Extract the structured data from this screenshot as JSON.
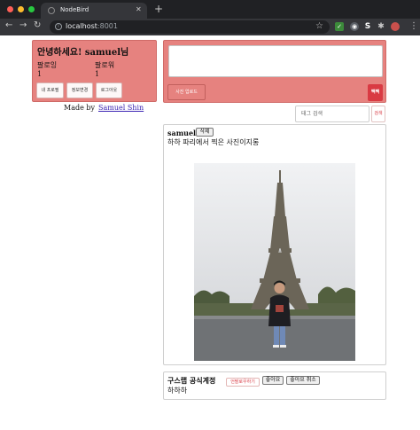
{
  "browser": {
    "tab_title": "NodeBird",
    "url_host": "localhost",
    "url_port": ":8001",
    "colors": {
      "close": "#ff5f57",
      "minimize": "#febc2e",
      "zoom": "#28c840"
    },
    "icons": [
      "back-icon",
      "forward-icon",
      "reload-icon",
      "info-icon",
      "star-icon",
      "extensions-icon",
      "menu-icon"
    ]
  },
  "profile": {
    "greeting": "안녕하세요! samuel님",
    "following_label": "팔로잉",
    "following_count": "1",
    "follower_label": "팔로워",
    "follower_count": "1",
    "buttons": {
      "my_profile": "내 프로필",
      "edit_info": "정보변경",
      "logout": "로그아웃"
    }
  },
  "footer": {
    "made_by": "Made by",
    "author_link": "Samuel Shin"
  },
  "post_form": {
    "upload_label": "사진 업로드",
    "submit_label": "짹짹"
  },
  "search": {
    "placeholder": "태그 검색",
    "button_label": "검색"
  },
  "posts": [
    {
      "author": "samuel",
      "delete_label": "삭제",
      "content": "하하 파리에서 찍은 사진이지롱"
    },
    {
      "author": "구스랩 공식계정",
      "follow_label": "언팔로우하기",
      "like_label": "좋아요",
      "unlike_label": "좋아요 취소",
      "content": "하하하"
    }
  ],
  "theme": {
    "card_bg": "#e6827f",
    "accent_red": "#d93a43"
  }
}
